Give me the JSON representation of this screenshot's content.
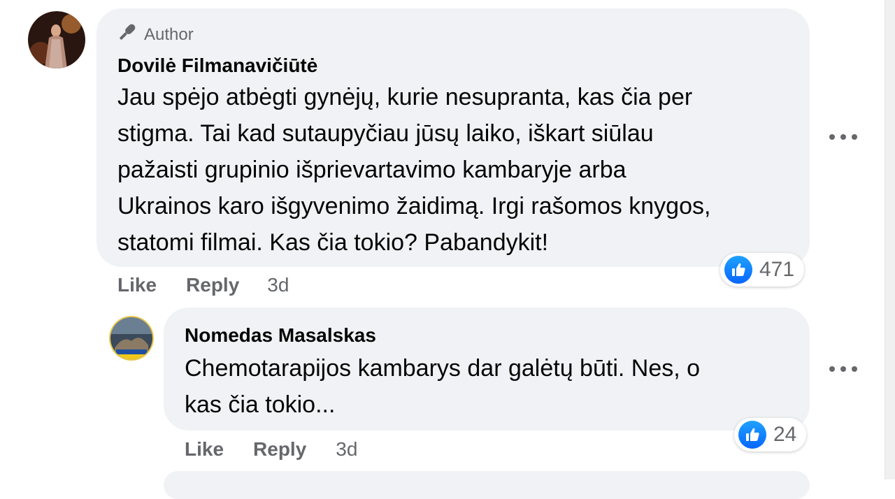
{
  "comment": {
    "badge_label": "Author",
    "author_name": "Dovilė Filmanavičiūtė",
    "text_lines": [
      "Jau spėjo atbėgti gynėjų, kurie nesupranta, kas čia per",
      "stigma. Tai kad sutaupyčiau jūsų laiko, iškart siūlau",
      "pažaisti grupinio išprievartavimo kambaryje arba",
      "Ukrainos karo išgyvenimo žaidimą. Irgi rašomos knygos,",
      "statomi filmai. Kas čia tokio? Pabandykit!"
    ],
    "reaction_count": "471",
    "like_label": "Like",
    "reply_label": "Reply",
    "timestamp": "3d"
  },
  "reply": {
    "author_name": "Nomedas Masalskas",
    "text_lines": [
      "Chemotarapijos kambarys dar galėtų būti. Nes, o",
      "kas čia tokio..."
    ],
    "reaction_count": "24",
    "like_label": "Like",
    "reply_label": "Reply",
    "timestamp": "3d"
  },
  "colors": {
    "bubble": "#f0f2f5",
    "secondary_text": "#65676b",
    "like_blue": "#0866ff"
  }
}
